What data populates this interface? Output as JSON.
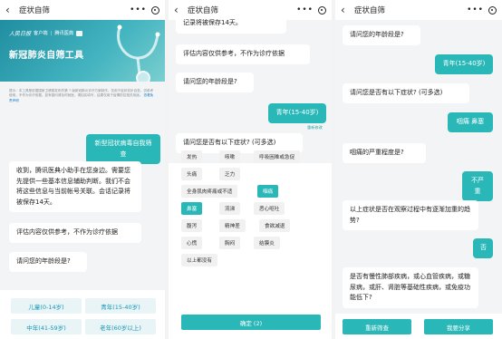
{
  "nav": {
    "back": "‹",
    "title": "症状自筛",
    "more": "•••"
  },
  "panel1": {
    "banner": {
      "logo_sig": "人民日报",
      "logo_client": "客户端",
      "logo_tencent": "腾讯医典",
      "logo_org": "",
      "title": "新冠肺炎自筛工具"
    },
    "notice_text": "提示：本工具是依据国家卫健委发布的第 7 版新冠肺炎诊疗方案制作，仅用于症状初步自查，供参考使用，不作为诊疗依据。如有疑问请及时就医，请如实填写，结果仅用于疫情防控相关用途。",
    "notice_link": "查看免责声明",
    "user_msg": "新型冠状病毒自我筛查",
    "bot_intro": "收到，腾讯医典小助手在您身边。需要您先提供一些基本信息辅助判断。我们不会将这些信息与当前帐号关联。会话记录将被保存14天。",
    "bot_ref": "评估内容仅供参考，不作为诊疗依据",
    "bot_age": "请问您的年龄段是?",
    "age_options": [
      "儿童(0-14岁)",
      "青年(15-40岁)",
      "中年(41-59岁)",
      "老年(60岁以上)"
    ]
  },
  "panel2": {
    "bot_intro_tail": "记录将被保存14天。",
    "bot_ref": "评估内容仅供参考，不作为诊疗依据",
    "bot_age": "请问您的年龄段是?",
    "user_age": "青年(15-40岁)",
    "reselect": "重新修改",
    "bot_symptom": "请问您是否有以下症状? (可多选)",
    "symptoms": [
      "发热",
      "咳嗽",
      "呼吸困难或急促",
      "头痛",
      "乏力",
      "全身肌肉疼痛或不适",
      "咽痛",
      "鼻塞",
      "流涕",
      "恶心呕吐",
      "腹泻",
      "精神差",
      "食欲减退",
      "心慌",
      "胸闷",
      "结膜炎",
      "以上都没有"
    ],
    "selected": [
      "咽痛",
      "鼻塞"
    ],
    "confirm": "确定 (2)"
  },
  "panel3": {
    "bot_age": "请问您的年龄段是?",
    "user_age": "青年(15-40岁)",
    "bot_symptom": "请问您是否有以下症状? (可多选)",
    "user_symptom": "咽痛 鼻塞",
    "bot_severity": "咽痛的严重程度是?",
    "user_severity": "不严重",
    "bot_trend": "以上症状是否在观察过程中有逐渐加重的趋势?",
    "user_trend": "否",
    "bot_chronic": "是否有慢性肺部疾病，或心血管疾病，或糖尿病，或肝、肾脏等基础性疾病，或免疫功能低下?",
    "restart": "重新筛查",
    "share": "我要分享"
  },
  "colors": {
    "accent": "#2ab7b8",
    "option_text": "#1796b7",
    "option_bg": "#e9f4f6"
  },
  "icons": {
    "back": "chevron-left-icon",
    "more": "more-dots-icon",
    "close": "target-close-icon"
  }
}
